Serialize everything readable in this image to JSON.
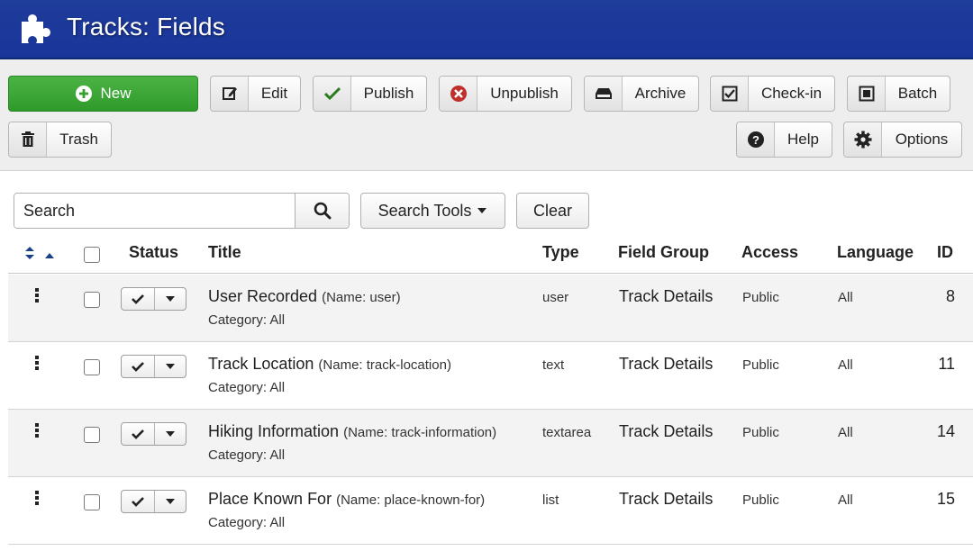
{
  "header": {
    "title": "Tracks: Fields"
  },
  "toolbar": {
    "new": "New",
    "edit": "Edit",
    "publish": "Publish",
    "unpublish": "Unpublish",
    "archive": "Archive",
    "checkin": "Check-in",
    "batch": "Batch",
    "trash": "Trash",
    "help": "Help",
    "options": "Options"
  },
  "filter": {
    "search_placeholder": "Search",
    "search_tools": "Search Tools",
    "clear": "Clear"
  },
  "table": {
    "headers": {
      "status": "Status",
      "title": "Title",
      "type": "Type",
      "field_group": "Field Group",
      "access": "Access",
      "language": "Language",
      "id": "ID"
    },
    "rows": [
      {
        "title": "User Recorded",
        "name": "(Name: user)",
        "category": "Category: All",
        "type": "user",
        "group": "Track Details",
        "access": "Public",
        "language": "All",
        "id": "8"
      },
      {
        "title": "Track Location",
        "name": "(Name: track-location)",
        "category": "Category: All",
        "type": "text",
        "group": "Track Details",
        "access": "Public",
        "language": "All",
        "id": "11"
      },
      {
        "title": "Hiking Information",
        "name": "(Name: track-information)",
        "category": "Category: All",
        "type": "textarea",
        "group": "Track Details",
        "access": "Public",
        "language": "All",
        "id": "14"
      },
      {
        "title": "Place Known For",
        "name": "(Name: place-known-for)",
        "category": "Category: All",
        "type": "list",
        "group": "Track Details",
        "access": "Public",
        "language": "All",
        "id": "15"
      }
    ]
  },
  "colors": {
    "header_bg": "#1a359a",
    "new_button": "#3aa534",
    "unpublish_icon": "#c0302a",
    "publish_check": "#2a7a1e"
  }
}
